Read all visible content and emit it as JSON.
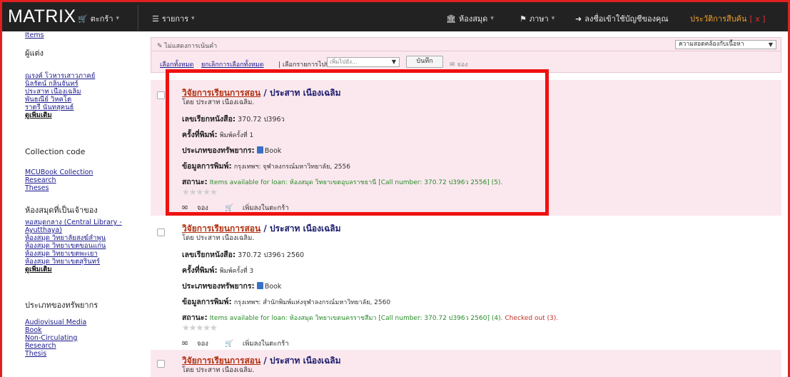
{
  "navbar": {
    "brand": "MATRIX",
    "cart": "ตะกร้า",
    "lists": "รายการ",
    "library": "ห้องสมุด",
    "language": "ภาษา",
    "login": "ลงชื่อเข้าใช้บัญชีของคุณ",
    "search_history": "ประวัติการสืบค้น",
    "history_x": "[ x ]"
  },
  "sidebar": {
    "top_link": "Items",
    "authors_head": "ผู้แต่ง",
    "authors": [
      "ณรงค์ โวหารเสาวภาคย์",
      "นิลรัตน์ กลิ่นจันทร์",
      "ประสาท เนืองเฉลิม",
      "พันธณีย์ วิหคโต",
      "ราตรี นันทสุคนธ์"
    ],
    "authors_more": "ดูเพิ่มเติม",
    "collection_head": "Collection code",
    "collections": [
      "MCUBook Collection",
      "Research",
      "Theses"
    ],
    "holding_head": "ห้องสมุดที่เป็นเจ้าของ",
    "holding": [
      "หอสมุดกลาง (Central Library - Ayutthaya)",
      "ห้องสมุด วิทยาลัยสงฆ์ลำพูน",
      "ห้องสมุด วิทยาเขตขอนแก่น",
      "ห้องสมุด วิทยาเขตพะเยา",
      "ห้องสมุด วิทยาเขตสุรินทร์"
    ],
    "holding_more": "ดูเพิ่มเติม",
    "itype_head": "ประเภทของทรัพยากร",
    "itypes": [
      "Audiovisual Media",
      "Book",
      "Non-Circulating",
      "Research",
      "Thesis"
    ]
  },
  "toolbar": {
    "unhighlight": "ไม่แสดงการเน้นคำ",
    "sort_value": "ความสอดคล้องกับเนื้อหา",
    "select_all": "เลือกทั้งหมด",
    "clear_all": "ยกเลิกการเลือกทั้งหมด",
    "selected_to": "เลือกรายการไปที่:",
    "add_to_placeholder": "เพิ่มไปยัง...",
    "save": "บันทึก",
    "hold": "จอง"
  },
  "labels": {
    "callno": "เลขเรียกหนังสือ:",
    "edition": "ครั้งที่พิมพ์:",
    "itype": "ประเภทของทรัพยากร:",
    "pub": "ข้อมูลการพิมพ์:",
    "status": "สถานะ:",
    "hold_action": "จอง",
    "cart_action": "เพิ่มลงในตะกร้า"
  },
  "records": [
    {
      "title": "วิจัยการเรียนการสอน",
      "title_rest": " / ประสาท เนืองเฉลิม",
      "by": "โดย ประสาท เนืองเฉลิม.",
      "callno": "370.72 ป396ว",
      "edition": "พิมพ์ครั้งที่ 1",
      "itype": "Book",
      "pub": "กรุงเทพฯ: จุฬาลงกรณ์มหาวิทยาลัย, 2556",
      "status_avail": "Items available for loan:",
      "status_detail": "ห้องสมุด วิทยาเขตอุบลราชธานี [Call number: 370.72 ป396ว 2556] (5).",
      "status_out": ""
    },
    {
      "title": "วิจัยการเรียนการสอน",
      "title_rest": " / ประสาท เนืองเฉลิม",
      "by": "โดย ประสาท เนืองเฉลิม.",
      "callno": "370.72 ป396ว 2560",
      "edition": "พิมพ์ครั้งที่ 3",
      "itype": "Book",
      "pub": "กรุงเทพฯ: สำนักพิมพ์แห่งจุฬาลงกรณ์มหาวิทยาลัย, 2560",
      "status_avail": "Items available for loan:",
      "status_detail": "ห้องสมุด วิทยาเขตนครราชสีมา [Call number: 370.72 ป396ว 2560] (4).",
      "status_out": "Checked out (3)."
    },
    {
      "title": "วิจัยการเรียนการสอน",
      "title_rest": " / ประสาท เนืองเฉลิม",
      "by": "โดย ประสาท เนืองเฉลิม."
    }
  ],
  "stars": "★★★★★",
  "colors": {
    "navbar": "#222222",
    "pink": "#fbe8ee",
    "highlight": "#ee1111",
    "available": "#2a8a2a",
    "history": "#f0a030"
  }
}
